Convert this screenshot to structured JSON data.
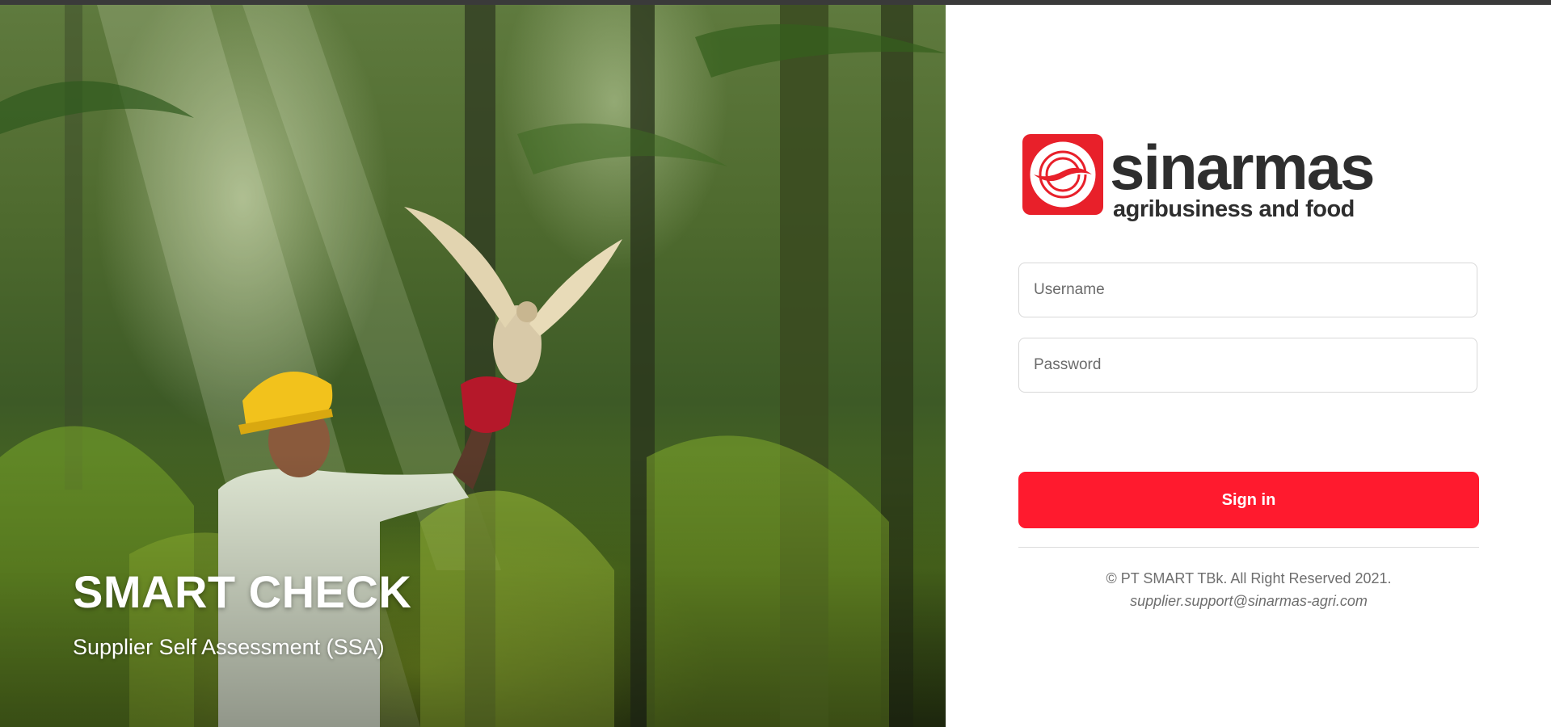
{
  "hero": {
    "title": "SMART CHECK",
    "subtitle": "Supplier Self Assessment (SSA)"
  },
  "brand": {
    "name": "sinarmas",
    "tagline": "agribusiness and food",
    "logo_color": "#e8202a"
  },
  "form": {
    "username_placeholder": "Username",
    "username_value": "",
    "password_placeholder": "Password",
    "password_value": "",
    "signin_label": "Sign in",
    "signin_color": "#ff1a2e"
  },
  "footer": {
    "copyright": "© PT SMART TBk. All Right Reserved 2021.",
    "support_email": "supplier.support@sinarmas-agri.com"
  }
}
